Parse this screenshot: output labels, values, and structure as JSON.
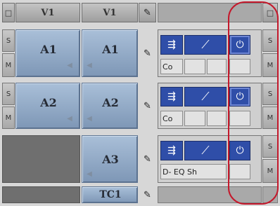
{
  "header": {
    "record_button": "□",
    "v1_source": "V1",
    "v1_record": "V1",
    "monitor_button": "□"
  },
  "tracks": [
    {
      "source": "A1",
      "record": "A1",
      "solo": "S",
      "mute": "M",
      "solo_right": "S",
      "mute_right": "M",
      "insert_label": "Co"
    },
    {
      "source": "A2",
      "record": "A2",
      "solo": "S",
      "mute": "M",
      "solo_right": "S",
      "mute_right": "M",
      "insert_label": "Co"
    },
    {
      "source": "",
      "record": "A3",
      "solo_right": "S",
      "mute_right": "M",
      "insert_label": "D- EQ Sh"
    }
  ],
  "timecode": {
    "label": "TC1"
  },
  "effects": {
    "fx_icon": "⇶",
    "curve_icon": "⟋",
    "power_icon": "⏻"
  }
}
